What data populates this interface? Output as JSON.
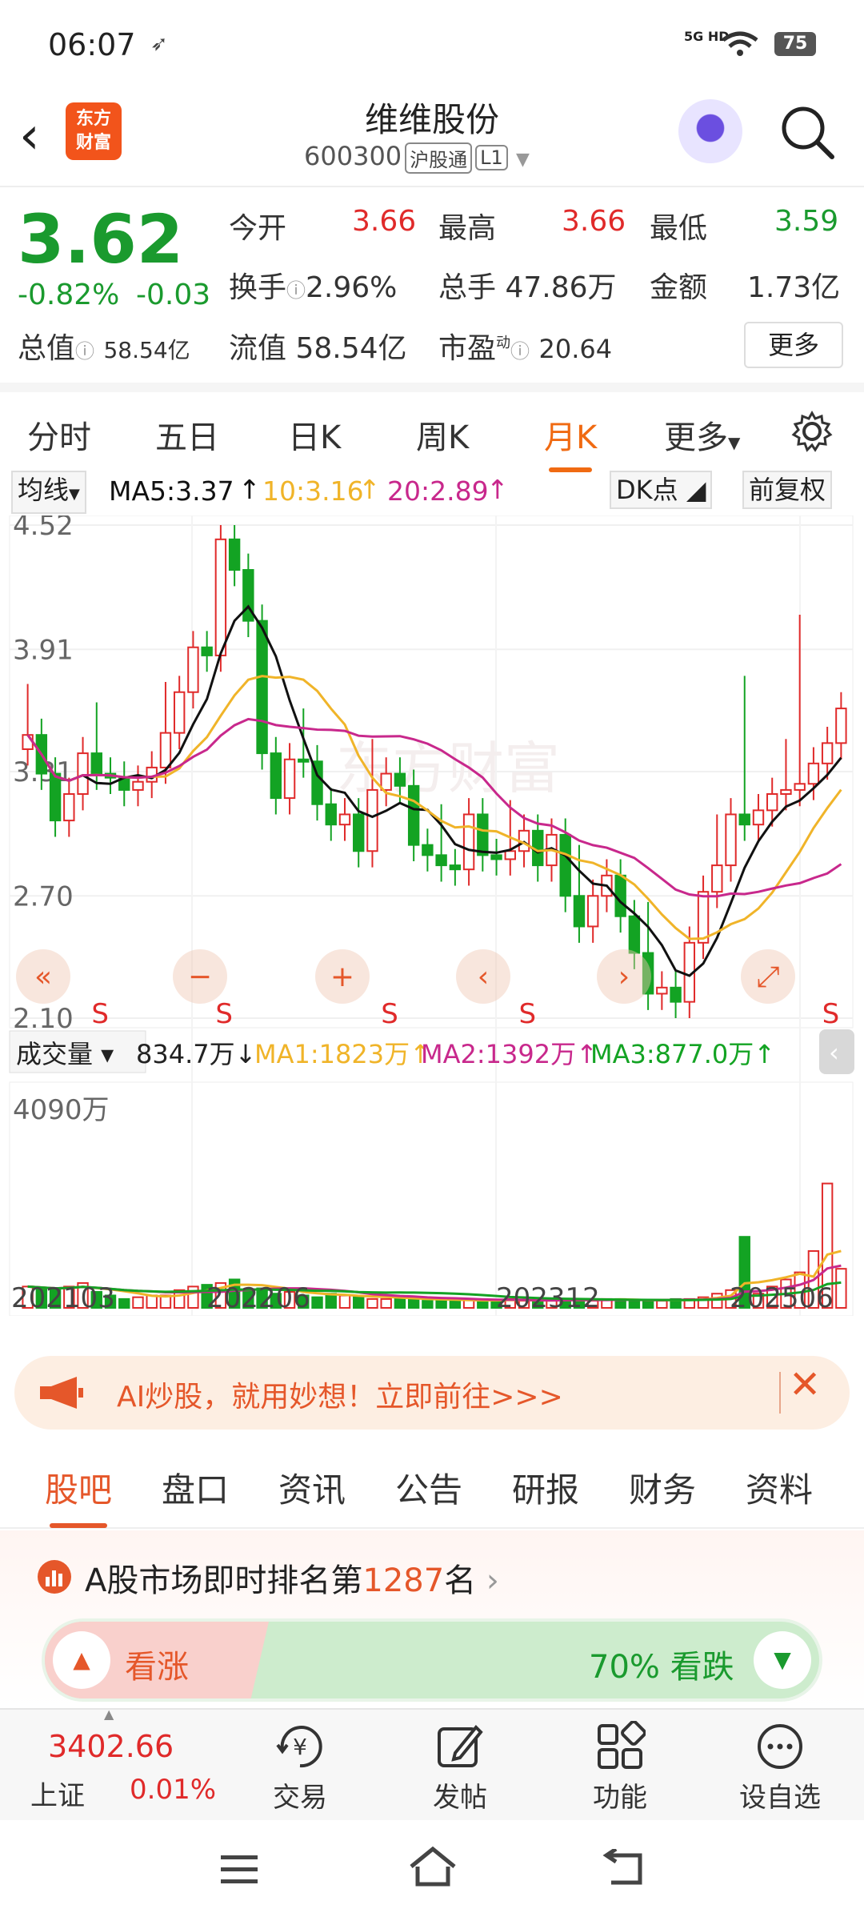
{
  "status": {
    "time": "06:07",
    "network": "5G HD",
    "battery": "75"
  },
  "header": {
    "stock_name": "维维股份",
    "stock_code": "600300",
    "tag_market": "沪股通",
    "tag_level": "L1",
    "logo_line1": "东方",
    "logo_line2": "财富"
  },
  "quote": {
    "price": "3.62",
    "change_pct": "-0.82%",
    "change": "-0.03",
    "open_label": "今开",
    "open": "3.66",
    "high_label": "最高",
    "high": "3.66",
    "low_label": "最低",
    "low": "3.59",
    "turnover_label": "换手",
    "turnover": "2.96%",
    "volume_label": "总手",
    "volume": "47.86万",
    "amount_label": "金额",
    "amount": "1.73亿",
    "mktcap_label": "总值",
    "mktcap": "58.54亿",
    "float_label": "流值",
    "float_cap": "58.54亿",
    "pe_label": "市盈",
    "pe_sup": "动",
    "pe": "20.64",
    "more": "更多"
  },
  "ktabs": [
    "分时",
    "五日",
    "日K",
    "周K",
    "月K",
    "更多"
  ],
  "chart_bar": {
    "ma_label": "均线",
    "ma5": "MA5:3.37",
    "ma10": "10:3.16",
    "ma20": "20:2.89",
    "dk": "DK点",
    "fq": "前复权"
  },
  "chart_data": {
    "type": "candlestick",
    "y_ticks": [
      "4.52",
      "3.91",
      "3.31",
      "2.70",
      "2.10"
    ],
    "ylim": [
      2.1,
      4.52
    ],
    "x_ticks": [
      "202103",
      "202206",
      "202312",
      "202506"
    ],
    "ma5_last": 3.37,
    "ma10_last": 3.16,
    "ma20_last": 2.89,
    "volume_max_label": "4090万",
    "vol_bar": {
      "label": "成交量",
      "value": "834.7万",
      "ma1": "MA1:1823万",
      "ma2": "MA2:1392万",
      "ma3": "MA3:877.0万"
    },
    "colors": {
      "up": "#e02a2a",
      "down": "#13a323",
      "ma5": "#111111",
      "ma10": "#f0b429",
      "ma20": "#c8288c"
    }
  },
  "banner": {
    "text": "AI炒股，就用妙想！立即前往>>>"
  },
  "subtabs": [
    "股吧",
    "盘口",
    "资讯",
    "公告",
    "研报",
    "财务",
    "资料"
  ],
  "rank": {
    "prefix": "A股市场即时排名第",
    "num": "1287",
    "suffix": "名"
  },
  "vote": {
    "up_label": "看涨",
    "down_label": "70% 看跌"
  },
  "bottom": {
    "index_value": "3402.66",
    "index_name": "上证",
    "index_change": "0.01%",
    "items": [
      "交易",
      "发帖",
      "功能",
      "设自选"
    ]
  }
}
